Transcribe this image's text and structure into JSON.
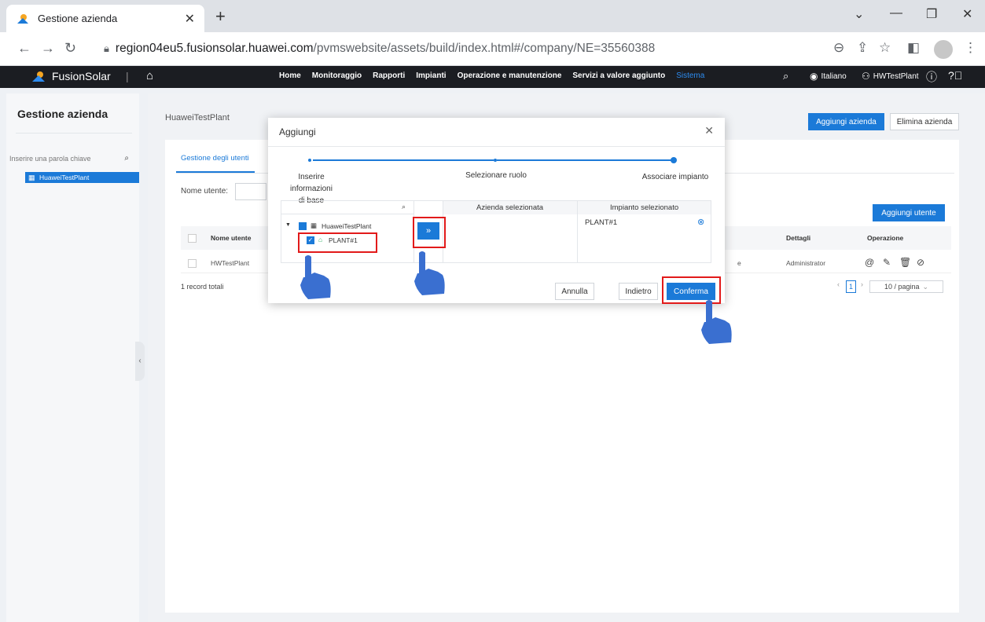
{
  "browser": {
    "tab_title": "Gestione azienda",
    "url_host": "region04eu5.fusionsolar.huawei.com",
    "url_path": "/pvmswebsite/assets/build/index.html#/company/NE=35560388"
  },
  "header": {
    "brand": "FusionSolar",
    "menu": [
      "Home",
      "Monitoraggio",
      "Rapporti",
      "Impianti",
      "Operazione e manutenzione",
      "Servizi a valore aggiunto",
      "Sistema"
    ],
    "active_menu": "Sistema",
    "language": "Italiano",
    "user": "HWTestPlant"
  },
  "sidebar": {
    "title": "Gestione azienda",
    "search_placeholder": "Inserire una parola chiave",
    "tree_item": "HuaweiTestPlant"
  },
  "main": {
    "company_name": "HuaweiTestPlant",
    "add_company": "Aggiungi azienda",
    "delete_company": "Elimina azienda",
    "tab": "Gestione degli utenti",
    "username_label": "Nome utente:",
    "add_user": "Aggiungi utente",
    "columns": {
      "name": "Nome utente",
      "details": "Dettagli",
      "operation": "Operazione"
    },
    "rows": [
      {
        "name": "HWTestPlant",
        "details": "Administrator",
        "mid_fragment": "e"
      }
    ],
    "total": "1 record totali",
    "current_page": "1",
    "page_size": "10 / pagina"
  },
  "modal": {
    "title": "Aggiungi",
    "steps": [
      "Inserire informazioni di base",
      "Selezionare ruolo",
      "Associare impianto"
    ],
    "step1_line1": "Inserire informazioni",
    "step1_line2": "di base",
    "tree_root": "HuaweiTestPlant",
    "tree_child": "PLANT#1",
    "col_company": "Azienda selezionata",
    "col_plant": "Impianto selezionato",
    "selected_plant": "PLANT#1",
    "move_button": "»",
    "cancel": "Annulla",
    "back": "Indietro",
    "confirm": "Conferma"
  },
  "colors": {
    "accent": "#1b7ad8",
    "highlight": "#e21a1a",
    "header_bg": "#1b1d22"
  }
}
